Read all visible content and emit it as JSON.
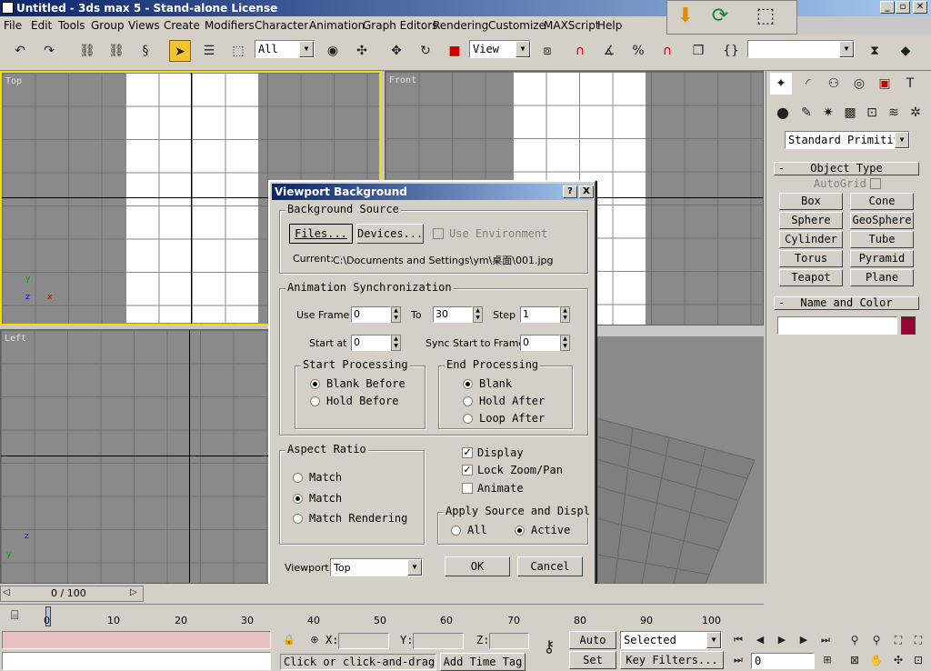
{
  "window": {
    "title": "Untitled - 3ds max 5 - Stand-alone License"
  },
  "menu": [
    "File",
    "Edit",
    "Tools",
    "Group",
    "Views",
    "Create",
    "Modifiers",
    "Character",
    "Animation",
    "Graph Editors",
    "Rendering",
    "Customize",
    "MAXScript",
    "Help"
  ],
  "toolbar": {
    "selection_filter": "All",
    "ref_coord": "View"
  },
  "viewports": {
    "top": "Top",
    "front": "Front",
    "left": "Left"
  },
  "command_panel": {
    "primitive_type": "Standard Primitiv",
    "object_type_title": "Object Type",
    "autogrid_label": "AutoGrid",
    "buttons": [
      "Box",
      "Cone",
      "Sphere",
      "GeoSphere",
      "Cylinder",
      "Tube",
      "Torus",
      "Pyramid",
      "Teapot",
      "Plane"
    ],
    "name_color_title": "Name and Color",
    "color": "#990033"
  },
  "dialog": {
    "title": "Viewport Background",
    "help": "?",
    "close": "X",
    "background_source": {
      "caption": "Background Source",
      "files_button": "Files...",
      "devices_button": "Devices...",
      "use_environment": "Use Environment",
      "current_label": "Current:",
      "current_path": "C:\\Documents and Settings\\ym\\桌面\\001.jpg"
    },
    "anim_sync": {
      "caption": "Animation Synchronization",
      "use_frame_label": "Use Frame",
      "use_frame_value": "0",
      "to_label": "To",
      "to_value": "30",
      "step_label": "Step",
      "step_value": "1",
      "start_at_label": "Start at",
      "start_at_value": "0",
      "sync_start_label": "Sync Start to Frame",
      "sync_start_value": "0"
    },
    "start_processing": {
      "caption": "Start Processing",
      "options": [
        "Blank Before",
        "Hold Before"
      ],
      "selected": 0
    },
    "end_processing": {
      "caption": "End Processing",
      "options": [
        "Blank",
        "Hold After",
        "Loop After"
      ],
      "selected": 0
    },
    "aspect_ratio": {
      "caption": "Aspect Ratio",
      "options": [
        "Match",
        "Match",
        "Match Rendering"
      ],
      "selected": 1
    },
    "checks": {
      "display": "Display",
      "lock_zoom": "Lock Zoom/Pan",
      "animate": "Animate"
    },
    "apply_source": {
      "caption": "Apply Source and Displ",
      "all": "All",
      "active": "Active"
    },
    "viewport_label": "Viewport:",
    "viewport_value": "Top",
    "ok": "OK",
    "cancel": "Cancel"
  },
  "timeline": {
    "frame_display": "0 / 100",
    "ticks": [
      "0",
      "10",
      "20",
      "30",
      "40",
      "50",
      "60",
      "70",
      "80",
      "90",
      "100"
    ]
  },
  "status": {
    "x_label": "X:",
    "y_label": "Y:",
    "z_label": "Z:",
    "prompt": "Click or click-and-drag",
    "add_time_tag": "Add Time Tag",
    "auto_key": "Auto Key",
    "set_key": "Set Key",
    "selected": "Selected",
    "key_filters": "Key Filters...",
    "current_frame": "0"
  }
}
